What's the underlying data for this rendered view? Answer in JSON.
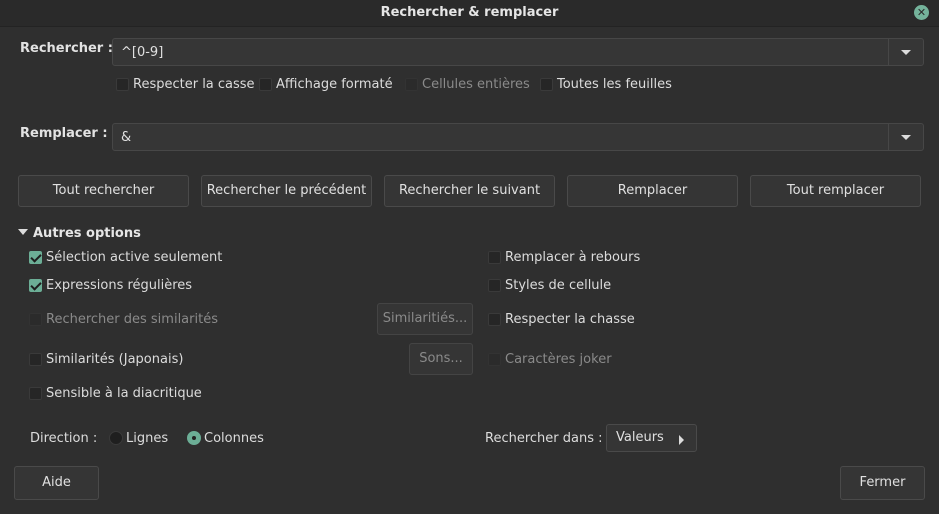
{
  "window": {
    "title": "Rechercher & remplacer"
  },
  "search": {
    "label": "Rechercher :",
    "value": "^[0-9]"
  },
  "search_options": [
    {
      "label": "Respecter la casse",
      "checked": false,
      "disabled": false
    },
    {
      "label": "Affichage formaté",
      "checked": false,
      "disabled": false
    },
    {
      "label": "Cellules entières",
      "checked": false,
      "disabled": true
    },
    {
      "label": "Toutes les feuilles",
      "checked": false,
      "disabled": false
    }
  ],
  "replace": {
    "label": "Remplacer :",
    "value": "&"
  },
  "actions": {
    "find_all": "Tout rechercher",
    "find_prev": "Rechercher le précédent",
    "find_next": "Rechercher le suivant",
    "replace": "Remplacer",
    "replace_all": "Tout remplacer"
  },
  "other_options": {
    "title": "Autres options",
    "left": [
      {
        "label": "Sélection active seulement",
        "checked": true,
        "disabled": false
      },
      {
        "label": "Expressions régulières",
        "checked": true,
        "disabled": false
      },
      {
        "label": "Rechercher des similarités",
        "checked": false,
        "disabled": true
      },
      {
        "label": "Similarités (Japonais)",
        "checked": false,
        "disabled": false
      },
      {
        "label": "Sensible à la diacritique",
        "checked": false,
        "disabled": false
      }
    ],
    "similarity_button": "Similaritiés...",
    "sounds_button": "Sons...",
    "right": [
      {
        "label": "Remplacer à rebours",
        "checked": false,
        "disabled": false
      },
      {
        "label": "Styles de cellule",
        "checked": false,
        "disabled": false
      },
      {
        "label": "Respecter la chasse",
        "checked": false,
        "disabled": false
      },
      {
        "label": "Caractères joker",
        "checked": false,
        "disabled": true
      }
    ],
    "direction": {
      "label": "Direction :",
      "options": [
        {
          "label": "Lignes",
          "selected": false
        },
        {
          "label": "Colonnes",
          "selected": true
        }
      ]
    },
    "search_in": {
      "label": "Rechercher dans :",
      "value": "Valeurs"
    }
  },
  "footer": {
    "help": "Aide",
    "close": "Fermer"
  }
}
